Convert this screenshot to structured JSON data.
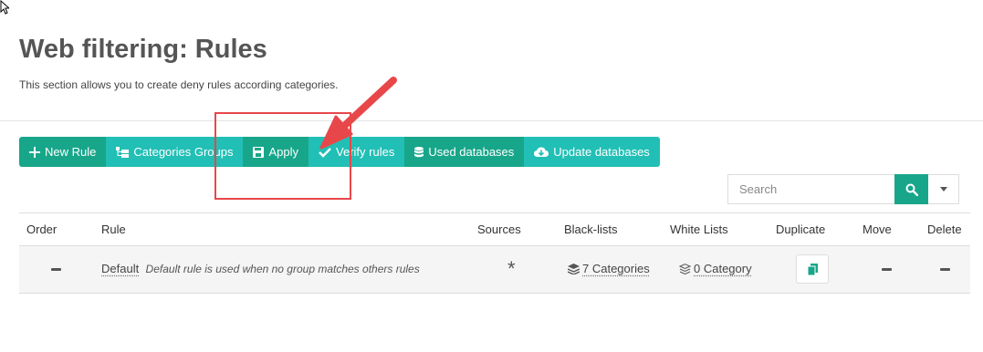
{
  "page": {
    "title": "Web filtering: Rules",
    "subtitle": "This section allows you to create deny rules according categories."
  },
  "toolbar": {
    "new_rule": "New Rule",
    "categories_groups": "Categories Groups",
    "apply": "Apply",
    "verify_rules": "Verify rules",
    "used_databases": "Used databases",
    "update_databases": "Update databases"
  },
  "search": {
    "placeholder": "Search"
  },
  "table": {
    "headers": {
      "order": "Order",
      "rule": "Rule",
      "sources": "Sources",
      "black_lists": "Black-lists",
      "white_lists": "White Lists",
      "duplicate": "Duplicate",
      "move": "Move",
      "delete": "Delete"
    },
    "rows": [
      {
        "rule_name": "Default",
        "rule_description": "Default rule is used when no group matches others rules",
        "sources": "*",
        "black_lists": "7 Categories",
        "white_lists": "0 Category"
      }
    ]
  },
  "colors": {
    "primary": "#18a68a",
    "accent": "#21bfb5",
    "annotation": "#e8474a"
  }
}
